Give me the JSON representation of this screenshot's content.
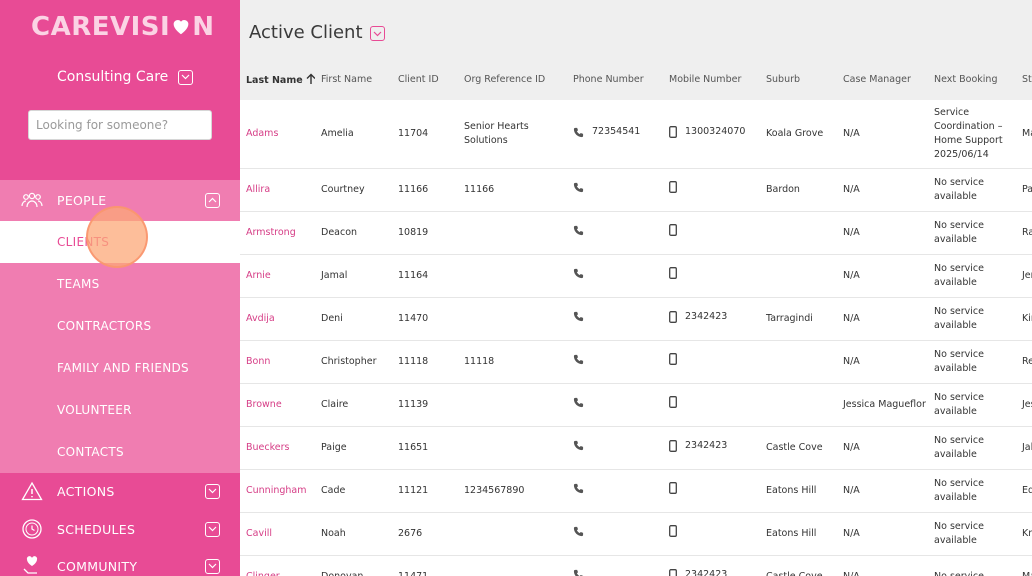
{
  "app": {
    "logo_text": "CAREVISI",
    "logo_tail": "N",
    "org_name": "Consulting Care"
  },
  "search": {
    "placeholder": "Looking for someone?"
  },
  "nav": {
    "people": "PEOPLE",
    "people_items": [
      "CLIENTS",
      "TEAMS",
      "CONTRACTORS",
      "FAMILY AND FRIENDS",
      "VOLUNTEER",
      "CONTACTS"
    ],
    "active_item": "CLIENTS",
    "actions": "ACTIONS",
    "schedules": "SCHEDULES",
    "community": "COMMUNITY"
  },
  "page": {
    "title": "Active Client"
  },
  "table": {
    "columns": [
      "Last Name",
      "First Name",
      "Client ID",
      "Org Reference ID",
      "Phone Number",
      "Mobile Number",
      "Suburb",
      "Case Manager",
      "Next Booking",
      "Sta"
    ],
    "rows": [
      [
        "Adams",
        "Amelia",
        "11704",
        "Senior Hearts Solutions",
        "72354541",
        "1300324070",
        "Koala Grove",
        "N/A",
        "Service Coordination – Home Support 2025/06/14",
        "Ma"
      ],
      [
        "Allira",
        "Courtney",
        "11166",
        "11166",
        "",
        "",
        "Bardon",
        "N/A",
        "No service available",
        "Pa"
      ],
      [
        "Armstrong",
        "Deacon",
        "10819",
        "",
        "",
        "",
        "",
        "N/A",
        "No service available",
        "Ra"
      ],
      [
        "Arnie",
        "Jamal",
        "11164",
        "",
        "",
        "",
        "",
        "N/A",
        "No service available",
        "Jer"
      ],
      [
        "Avdija",
        "Deni",
        "11470",
        "",
        "",
        "2342423",
        "Tarragindi",
        "N/A",
        "No service available",
        "Kir"
      ],
      [
        "Bonn",
        "Christopher",
        "11118",
        "11118",
        "",
        "",
        "",
        "N/A",
        "No service available",
        "Re"
      ],
      [
        "Browne",
        "Claire",
        "11139",
        "",
        "",
        "",
        "",
        "Jessica Magueflor",
        "No service available",
        "Jes"
      ],
      [
        "Bueckers",
        "Paige",
        "11651",
        "",
        "",
        "2342423",
        "Castle Cove",
        "N/A",
        "No service available",
        "Jal"
      ],
      [
        "Cunningham",
        "Cade",
        "11121",
        "1234567890",
        "",
        "",
        "Eatons Hill",
        "N/A",
        "No service available",
        "Ed"
      ],
      [
        "Cavill",
        "Noah",
        "2676",
        "",
        "",
        "",
        "Eatons Hill",
        "N/A",
        "No service available",
        "Kri"
      ],
      [
        "Clinger",
        "Donovan",
        "11471",
        "",
        "",
        "2342423",
        "Castle Cove",
        "N/A",
        "No service",
        "Ma"
      ]
    ]
  },
  "colors": {
    "brand": "#e84b95",
    "brand_light": "#f07db1",
    "link": "#d63d86"
  }
}
